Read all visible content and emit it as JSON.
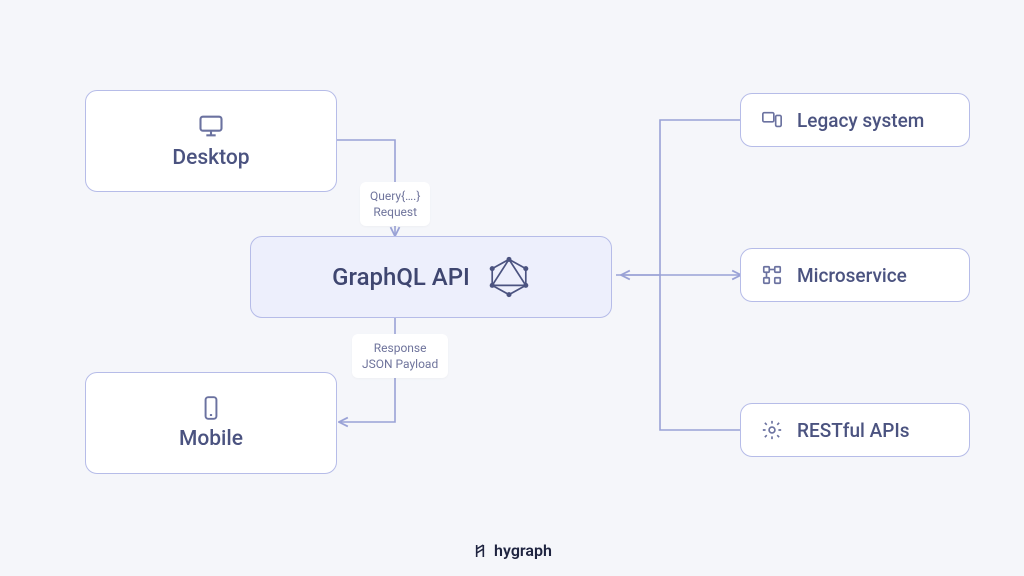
{
  "boxes": {
    "desktop": "Desktop",
    "mobile": "Mobile",
    "center": "GraphQL API",
    "legacy": "Legacy system",
    "microservice": "Microservice",
    "restful": "RESTful APIs"
  },
  "tags": {
    "request_line1": "Query{….}",
    "request_line2": "Request",
    "response_line1": "Response",
    "response_line2": "JSON Payload"
  },
  "brand": "hygraph",
  "colors": {
    "bg": "#F5F6FA",
    "border": "#B6BCE8",
    "centerFill": "#EDEFFC",
    "text": "#4B5380",
    "wire": "#9AA2D6"
  }
}
